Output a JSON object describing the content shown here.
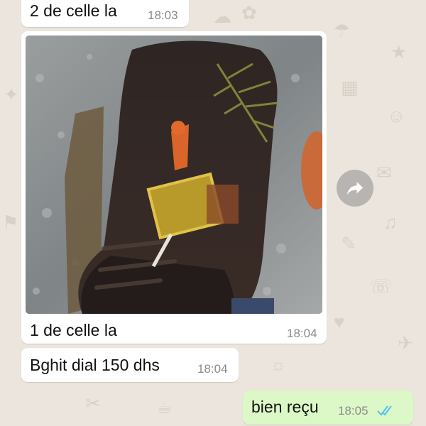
{
  "messages": [
    {
      "direction": "incoming",
      "text": "2 de celle la",
      "time": "18:03"
    },
    {
      "direction": "incoming",
      "type": "image",
      "caption": "1 de celle la",
      "time": "18:04"
    },
    {
      "direction": "incoming",
      "text": "Bghit dial 150 dhs",
      "time": "18:04"
    },
    {
      "direction": "outgoing",
      "text": "bien reçu",
      "time": "18:05",
      "status": "read"
    }
  ],
  "icons": {
    "forward": "forward-icon",
    "read_receipt": "double-check-icon"
  },
  "colors": {
    "wallpaper": "#ece5dd",
    "incoming_bubble": "#ffffff",
    "outgoing_bubble": "#dcf8c6",
    "read_receipt": "#4fc3f7"
  }
}
